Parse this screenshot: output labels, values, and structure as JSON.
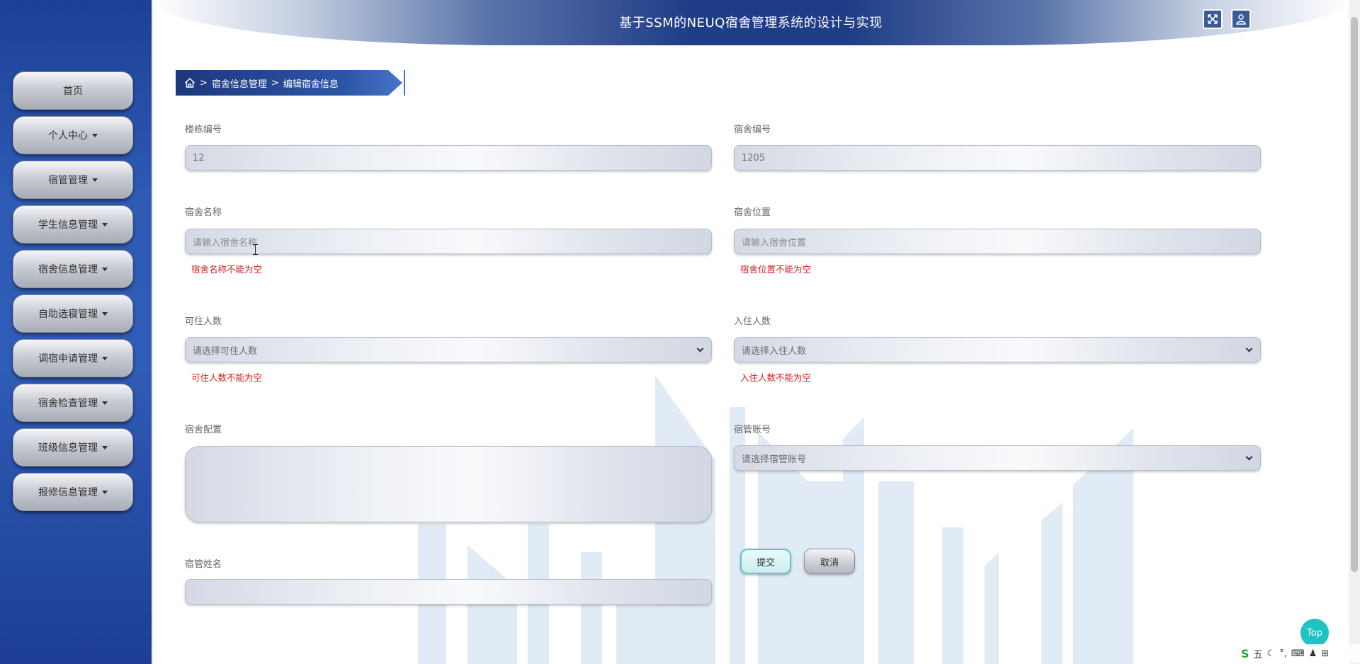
{
  "header": {
    "title": "基于SSM的NEUQ宿舍管理系统的设计与实现",
    "fullscreen_icon": "fullscreen-icon",
    "user_icon": "user-icon"
  },
  "sidebar": {
    "items": [
      {
        "label": "首页",
        "dropdown": false
      },
      {
        "label": "个人中心",
        "dropdown": true
      },
      {
        "label": "宿管管理",
        "dropdown": true
      },
      {
        "label": "学生信息管理",
        "dropdown": true
      },
      {
        "label": "宿舍信息管理",
        "dropdown": true
      },
      {
        "label": "自助选寝管理",
        "dropdown": true
      },
      {
        "label": "调宿申请管理",
        "dropdown": true
      },
      {
        "label": "宿舍检查管理",
        "dropdown": true
      },
      {
        "label": "班级信息管理",
        "dropdown": true
      },
      {
        "label": "报修信息管理",
        "dropdown": true
      }
    ]
  },
  "breadcrumb": {
    "home_icon": "home-icon",
    "sep": ">",
    "level1": "宿舍信息管理",
    "level2": "编辑宿舍信息"
  },
  "form": {
    "building_no": {
      "label": "楼栋编号",
      "value": "12"
    },
    "dorm_no": {
      "label": "宿舍编号",
      "value": "1205"
    },
    "dorm_name": {
      "label": "宿舍名称",
      "placeholder": "请输入宿舍名称",
      "error": "宿舍名称不能为空"
    },
    "dorm_location": {
      "label": "宿舍位置",
      "placeholder": "请输入宿舍位置",
      "error": "宿舍位置不能为空"
    },
    "capacity": {
      "label": "可住人数",
      "selected": "请选择可住人数",
      "error": "可住人数不能为空"
    },
    "occupants": {
      "label": "入住人数",
      "selected": "请选择入住人数",
      "error": "入住人数不能为空"
    },
    "config": {
      "label": "宿舍配置",
      "value": ""
    },
    "manager_account": {
      "label": "宿管账号",
      "selected": "请选择宿管账号"
    },
    "manager_name": {
      "label": "宿管姓名",
      "value": ""
    },
    "submit_label": "提交",
    "cancel_label": "取消"
  },
  "top_button": "Top",
  "ime": {
    "logo": "S",
    "mode": "五"
  },
  "colors": {
    "sidebar": "#2e5bb4",
    "header": "#1f3c86",
    "error": "#d21f1f",
    "submit_border": "#5cc7c6",
    "top_button": "#1fc3c3"
  }
}
